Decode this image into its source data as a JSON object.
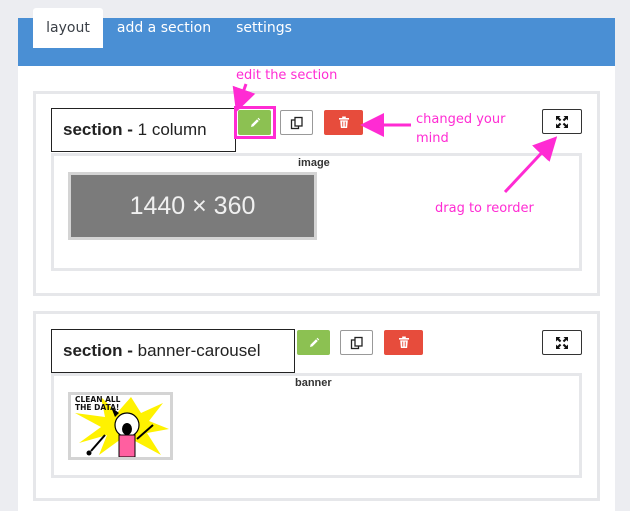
{
  "tabs": [
    {
      "label": "layout",
      "active": true
    },
    {
      "label": "add a section",
      "active": false
    },
    {
      "label": "settings",
      "active": false
    }
  ],
  "sections": [
    {
      "title_prefix": "section -",
      "title_name": "1 column",
      "inner_label": "image",
      "thumb_text": "1440 × 360"
    },
    {
      "title_prefix": "section -",
      "title_name": "banner-carousel",
      "inner_label": "banner",
      "thumb_text": "CLEAN ALL THE DATA!"
    }
  ],
  "annotations": {
    "edit": "edit the section",
    "delete": "changed your mind",
    "reorder": "drag to reorder"
  },
  "icons": {
    "edit": "pencil-icon",
    "copy": "copy-icon",
    "delete": "trash-icon",
    "move": "expand-icon"
  },
  "colors": {
    "tabbar": "#4a8fd4",
    "edit": "#8cc152",
    "delete": "#e74c3c",
    "annotation": "#ff2bd3"
  }
}
